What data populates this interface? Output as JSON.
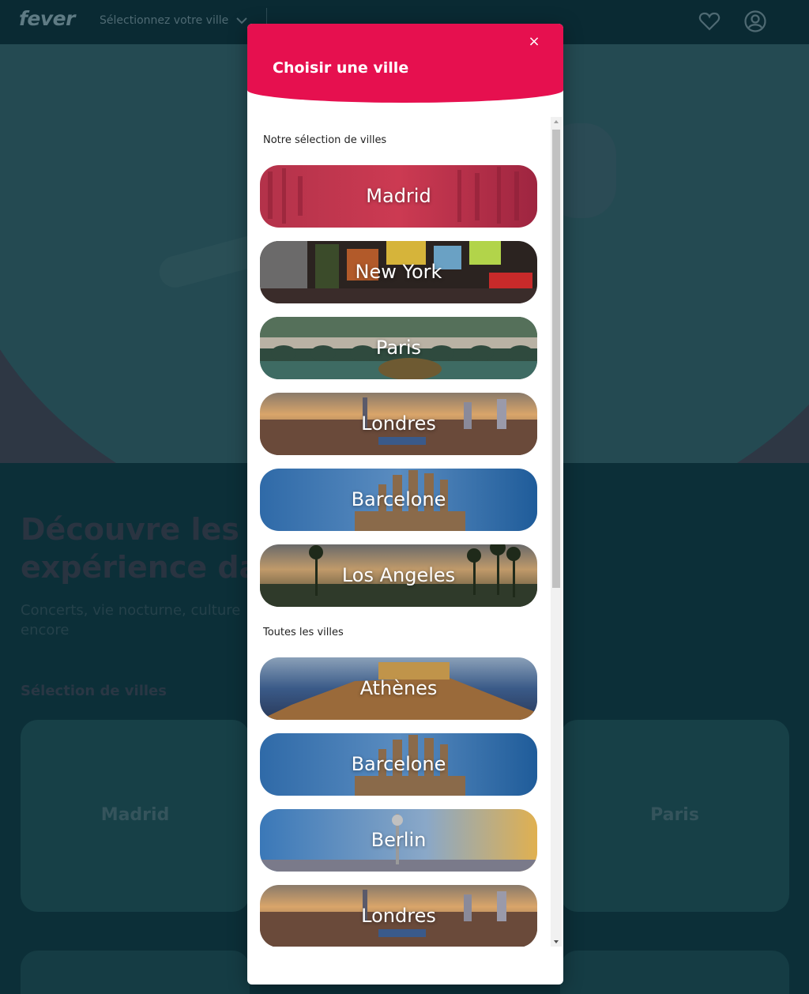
{
  "topbar": {
    "logo": "fever",
    "city_select_label": "Sélectionnez votre ville",
    "icons": {
      "favorites": "heart-icon",
      "account": "user-circle-icon",
      "dropdown": "chevron-down-icon"
    }
  },
  "hero": {
    "headline_line1": "Découvre les m",
    "headline_line2": "expérience da",
    "subline_line1": "Concerts, vie nocturne, culture",
    "subline_line2": "encore"
  },
  "city_section": {
    "title": "Sélection de villes",
    "cards": [
      "Madrid",
      "Paris"
    ]
  },
  "modal": {
    "title": "Choisir une ville",
    "close_label": "×",
    "accent_color": "#e6104f",
    "featured_label": "Notre sélection de villes",
    "featured_cities": [
      "Madrid",
      "New York",
      "Paris",
      "Londres",
      "Barcelone",
      "Los Angeles"
    ],
    "all_label": "Toutes les villes",
    "all_cities": [
      "Athènes",
      "Barcelone",
      "Berlin",
      "Londres"
    ]
  }
}
